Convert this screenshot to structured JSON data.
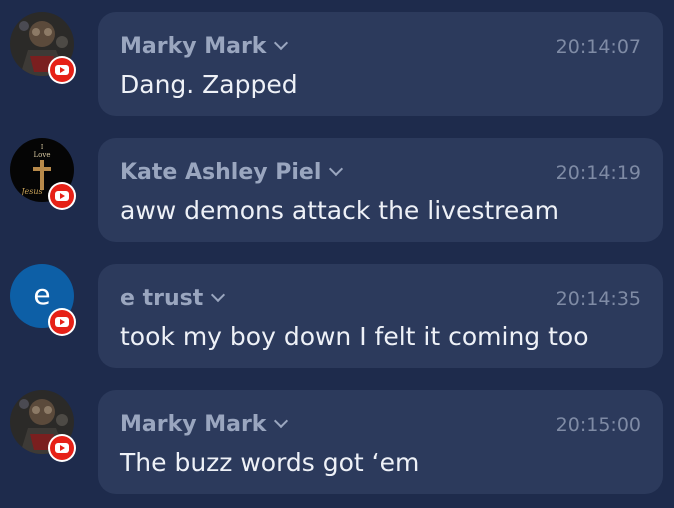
{
  "messages": [
    {
      "author": "Marky Mark",
      "time": "20:14:07",
      "text": "Dang. Zapped",
      "avatar_icon": "photo-avatar",
      "platform_icon": "youtube-icon"
    },
    {
      "author": "Kate Ashley Piel",
      "time": "20:14:19",
      "text": "aww demons attack the livestream",
      "avatar_icon": "cross-avatar",
      "avatar_text": [
        "I",
        "Love",
        "Jesus"
      ],
      "platform_icon": "youtube-icon"
    },
    {
      "author": "e trust",
      "time": "20:14:35",
      "text": "took my boy down I felt it coming too",
      "avatar_letter": "e",
      "platform_icon": "youtube-icon"
    },
    {
      "author": "Marky Mark",
      "time": "20:15:00",
      "text": "The buzz words got ‘em",
      "avatar_icon": "photo-avatar",
      "platform_icon": "youtube-icon"
    }
  ],
  "colors": {
    "background": "#1e2b4c",
    "bubble": "#2c3a5c",
    "author": "#9aa6bf",
    "time": "#7f8ba5",
    "text": "#eef1f7",
    "youtube_red": "#e62117",
    "letter_avatar": "#0d5fa6"
  }
}
